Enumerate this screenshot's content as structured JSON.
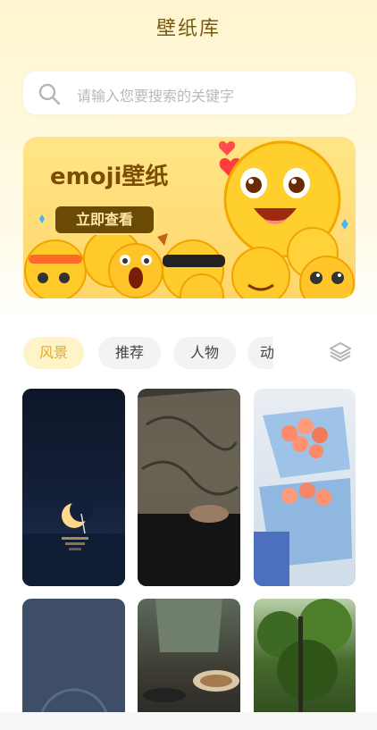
{
  "header": {
    "title": "壁纸库"
  },
  "search": {
    "placeholder": "请输入您要搜索的关键字",
    "icon": "search-icon"
  },
  "banner": {
    "title": "emoji壁纸",
    "button_label": "立即查看"
  },
  "tabs": [
    {
      "label": "风景",
      "active": true
    },
    {
      "label": "推荐",
      "active": false
    },
    {
      "label": "人物",
      "active": false
    },
    {
      "label": "动",
      "active": false
    }
  ],
  "colors": {
    "accent": "#e3aa2b",
    "brand_dark": "#7a5a12"
  }
}
